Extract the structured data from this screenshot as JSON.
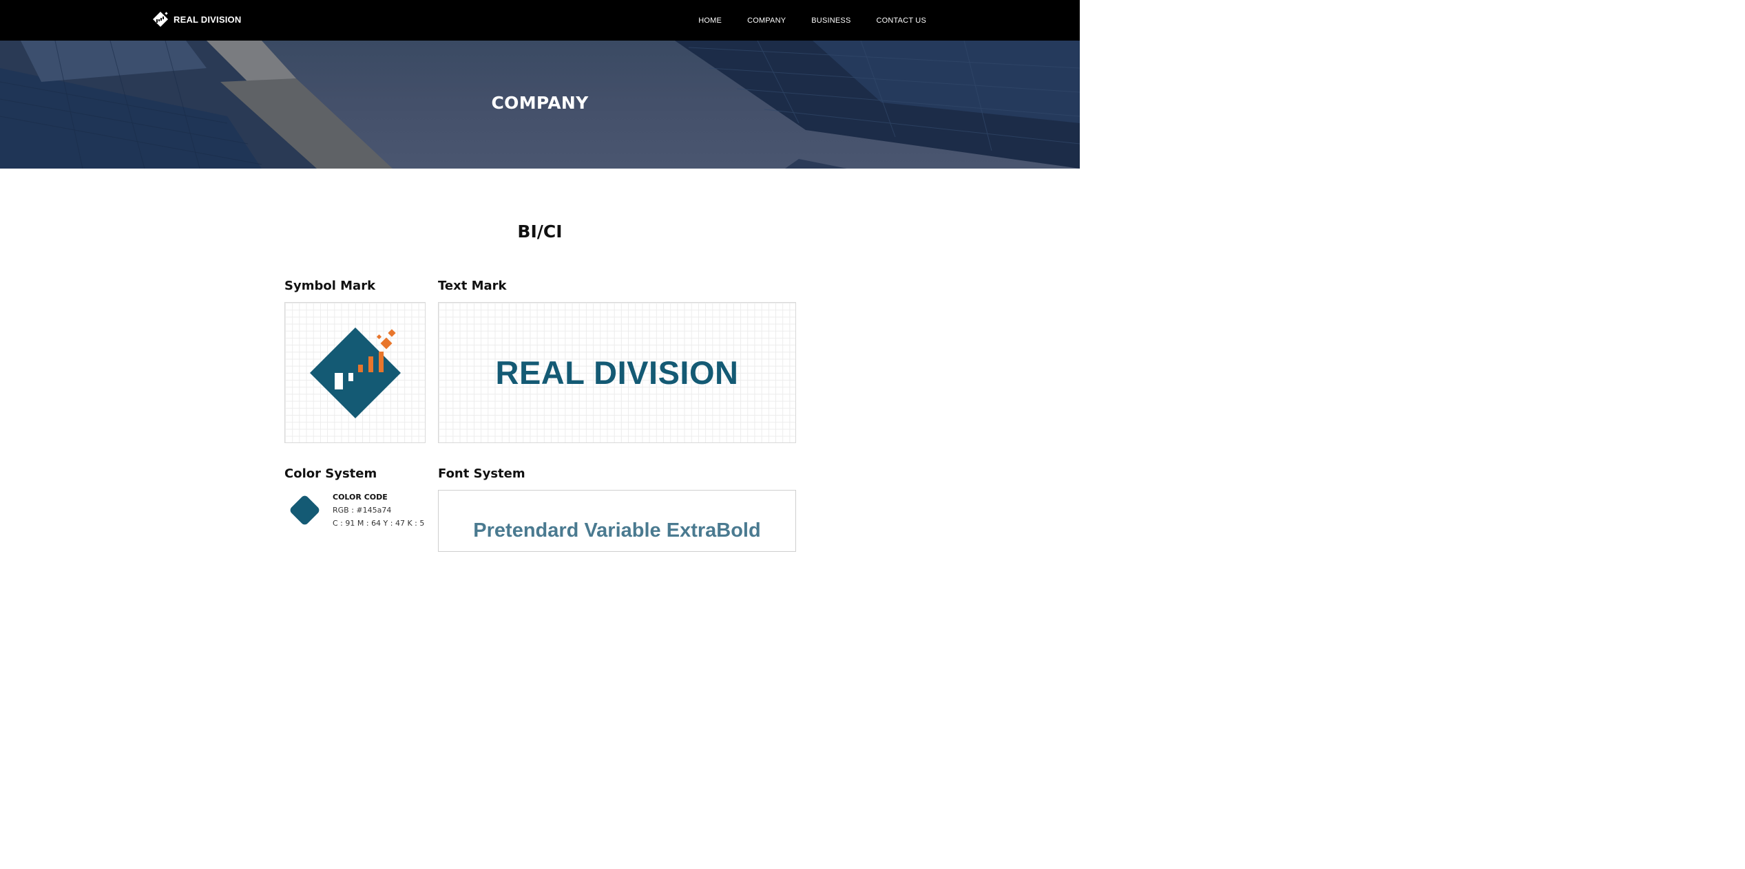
{
  "header": {
    "logo_text": "REAL DIVISION",
    "nav": [
      "HOME",
      "COMPANY",
      "BUSINESS",
      "CONTACT US"
    ]
  },
  "hero": {
    "title": "COMPANY"
  },
  "main": {
    "section_title": "BI/CI",
    "symbol_mark": {
      "label": "Symbol Mark"
    },
    "text_mark": {
      "label": "Text Mark",
      "text": "REAL DIVISION"
    },
    "color_system": {
      "label": "Color System",
      "code_title": "COLOR CODE",
      "rgb": "RGB : #145a74",
      "cmyk": "C : 91 M : 64 Y : 47 K : 5"
    },
    "font_system": {
      "label": "Font System",
      "sample": "Pretendard Variable ExtraBold"
    }
  },
  "colors": {
    "brand": "#145a74",
    "accent": "#e8762c",
    "header_bg": "#000000"
  },
  "icons": [
    "logo-icon",
    "symbol-mark-icon",
    "color-chip-icon"
  ]
}
